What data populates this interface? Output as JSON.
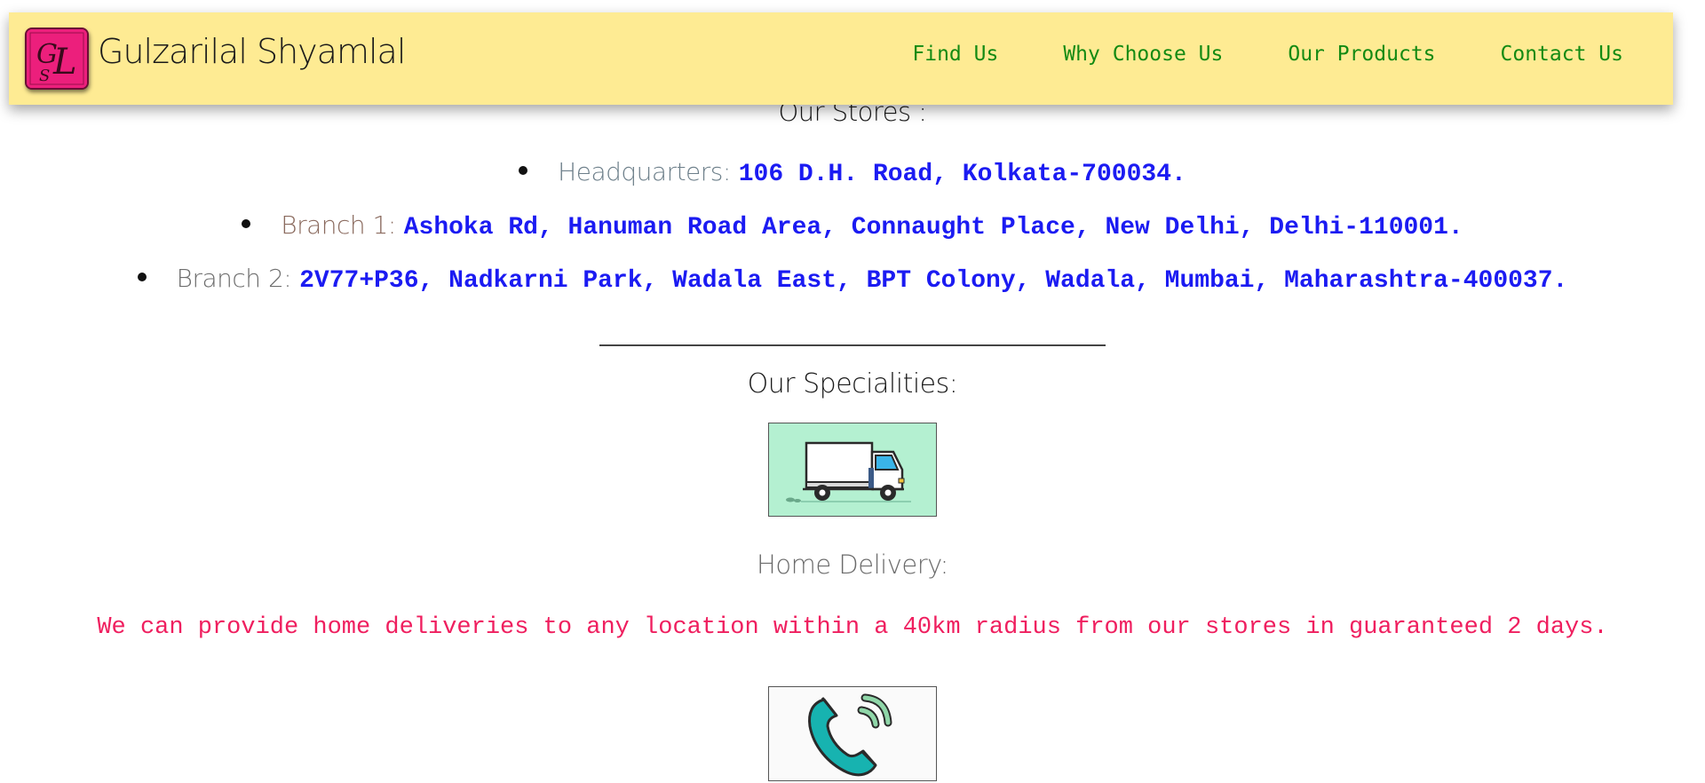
{
  "header": {
    "brand_name": "Gulzarilal Shyamlal",
    "logo_icon": "gl-monogram-logo-icon",
    "logo_color": "#ec1f7c",
    "background_color": "#feeb93",
    "nav": [
      {
        "label": "Find Us"
      },
      {
        "label": "Why Choose Us"
      },
      {
        "label": "Our Products"
      },
      {
        "label": "Contact Us"
      }
    ],
    "nav_color": "#138a13"
  },
  "stores": {
    "heading": "Our Stores :",
    "items": [
      {
        "label": "Headquarters:",
        "address": "106 D.H. Road, Kolkata-700034."
      },
      {
        "label": "Branch 1:",
        "address": "Ashoka Rd, Hanuman Road Area, Connaught Place, New Delhi, Delhi-110001."
      },
      {
        "label": "Branch 2:",
        "address": "2V77+P36, Nadkarni Park, Wadala East, BPT Colony, Wadala, Mumbai, Maharashtra-400037."
      }
    ],
    "address_color": "#1b1bf2"
  },
  "specialities": {
    "heading": "Our Specialities:",
    "delivery": {
      "icon": "delivery-truck-icon",
      "title": "Home Delivery:",
      "description": "We can provide home deliveries to any location within a 40km radius from our stores in guaranteed 2 days.",
      "description_color": "#ef1f5f"
    },
    "contact_icon": "phone-call-icon"
  }
}
